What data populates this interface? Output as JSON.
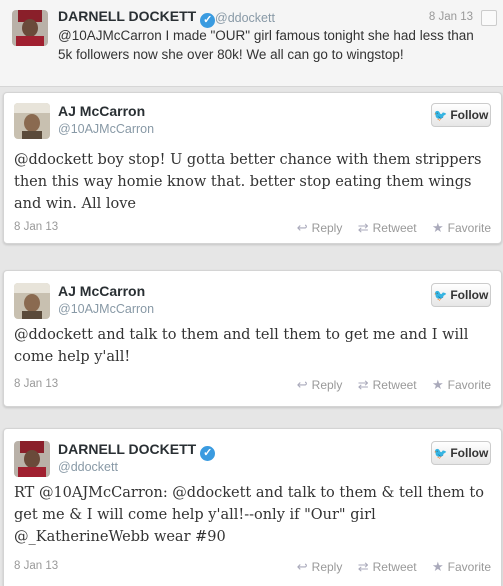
{
  "top_tweet": {
    "name": "DARNELL DOCKETT",
    "handle": "@ddockett",
    "date": "8 Jan 13",
    "text": "@10AJMcCarron                   I made \"OUR\" girl famous tonight she had less than 5k followers now she over 80k! We all can go to wingstop!"
  },
  "tweets": [
    {
      "name": "AJ McCarron",
      "handle": "@10AJMcCarron",
      "follow_label": "Follow",
      "text": "@ddockett boy stop! U gotta better chance with them strippers then this way homie know that. better stop eating them wings and win. All love",
      "date": "8 Jan 13"
    },
    {
      "name": "AJ McCarron",
      "handle": "@10AJMcCarron",
      "follow_label": "Follow",
      "text": "@ddockett and talk to them and tell them to get me and I will come help y'all!",
      "date": "8 Jan 13"
    },
    {
      "name": "DARNELL DOCKETT",
      "handle": "@ddockett",
      "follow_label": "Follow",
      "text": "RT @10AJMcCarron: @ddockett and talk to them & tell them to get me & I will come help y'all!--only if \"Our\" girl @_KatherineWebb wear #90",
      "date": "8 Jan 13"
    }
  ],
  "actions": {
    "reply": "Reply",
    "retweet": "Retweet",
    "favorite": "Favorite"
  },
  "colors": {
    "verified": "#3a9be0",
    "bird": "#2fa5e0"
  }
}
